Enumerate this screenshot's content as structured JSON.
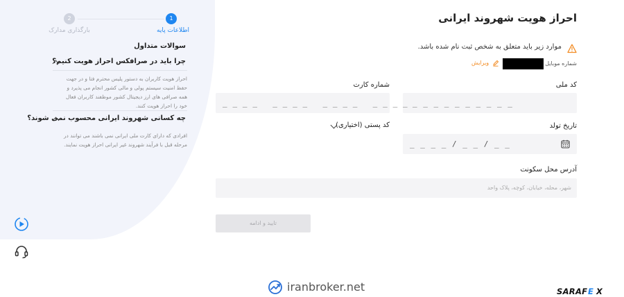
{
  "stepper": {
    "steps": [
      {
        "number": "1",
        "label": "اطلاعات پایه",
        "active": true
      },
      {
        "number": "2",
        "label": "بارگذاری مدارک",
        "active": false
      }
    ]
  },
  "faq": {
    "title": "سوالات متداول",
    "items": [
      {
        "question": "چرا باید در صرافکس احراز هویت کنیم؟",
        "answer_lines": [
          "احراز هویت کاربران به دستور پلیس محترم فتا و در جهت",
          "حفظ امنیت سیستم پولی و مالی کشور انجام می پذیرد و",
          "همه صرافی های ارز دیجیتال کشور موظفند کاربران فعال",
          "خود را احراز هویت کنند."
        ]
      },
      {
        "question": "چه کسانی شهروند ایرانی محسوب نمی شوند؟",
        "answer_lines": [
          "افرادی که دارای کارت ملی ایرانی نمی باشند می توانند در",
          "مرحله قبل با فرآیند شهروند غیر ایرانی احراز هویت نمایند."
        ]
      }
    ]
  },
  "form": {
    "title": "احراز هویت شهروند ایرانی",
    "warning": "موارد زیر باید متعلق به شخص ثبت نام شده باشد.",
    "mobile_label": "شماره موبایل",
    "edit_label": "ویرایش",
    "national_code": {
      "label": "کد ملی",
      "mask": "_ _ _ _ _ _ _ _ _ _"
    },
    "card_number": {
      "label": "شماره کارت",
      "mask": "_ _ _ _   _ _ _ _   _ _ _ _   _ _ _ _"
    },
    "birth_date": {
      "label": "تاریخ تولد",
      "mask": "_ _ _ _ / _ _ / _ _"
    },
    "postal_code": {
      "label": "کد پستی (اختیاری)"
    },
    "address": {
      "label": "آدرس محل سکونت",
      "placeholder": "شهر، محله، خیابان، کوچه، پلاک واحد"
    },
    "submit_label": "تایید و ادامه"
  },
  "watermark": "iranbroker.net",
  "brand_logo": "SARAFEX",
  "colors": {
    "accent": "#1f86f0",
    "warning": "#f28b22",
    "chat": "#1f86f0"
  }
}
